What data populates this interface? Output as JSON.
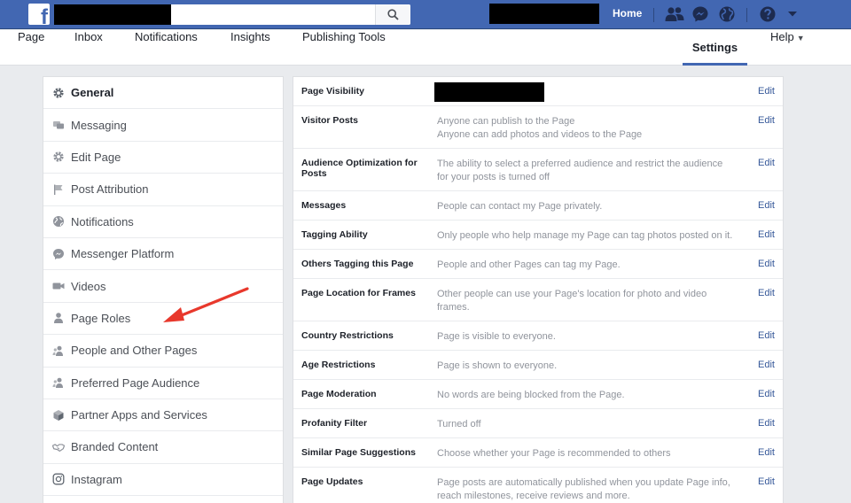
{
  "topbar": {
    "logo_letter": "f",
    "search_placeholder": "",
    "home_label": "Home"
  },
  "nav": {
    "items": [
      "Page",
      "Inbox",
      "Notifications",
      "Insights",
      "Publishing Tools"
    ],
    "settings_label": "Settings",
    "help_label": "Help"
  },
  "sidebar": {
    "items": [
      {
        "label": "General",
        "icon": "gear-icon"
      },
      {
        "label": "Messaging",
        "icon": "messaging-icon"
      },
      {
        "label": "Edit Page",
        "icon": "gear-icon"
      },
      {
        "label": "Post Attribution",
        "icon": "flag-icon"
      },
      {
        "label": "Notifications",
        "icon": "globe-icon"
      },
      {
        "label": "Messenger Platform",
        "icon": "messenger-icon"
      },
      {
        "label": "Videos",
        "icon": "video-icon"
      },
      {
        "label": "Page Roles",
        "icon": "person-icon"
      },
      {
        "label": "People and Other Pages",
        "icon": "people-icon"
      },
      {
        "label": "Preferred Page Audience",
        "icon": "people-icon"
      },
      {
        "label": "Partner Apps and Services",
        "icon": "cube-icon"
      },
      {
        "label": "Branded Content",
        "icon": "handshake-icon"
      },
      {
        "label": "Instagram",
        "icon": "instagram-icon"
      }
    ]
  },
  "settings": {
    "edit_label": "Edit",
    "rows": [
      {
        "label": "Page Visibility",
        "line1": "",
        "line2": ""
      },
      {
        "label": "Visitor Posts",
        "line1": "Anyone can publish to the Page",
        "line2": "Anyone can add photos and videos to the Page"
      },
      {
        "label": "Audience Optimization for Posts",
        "line1": "The ability to select a preferred audience and restrict the audience",
        "line2": "for your posts is turned off"
      },
      {
        "label": "Messages",
        "line1": "People can contact my Page privately.",
        "line2": ""
      },
      {
        "label": "Tagging Ability",
        "line1": "Only people who help manage my Page can tag photos posted on it.",
        "line2": ""
      },
      {
        "label": "Others Tagging this Page",
        "line1": "People and other Pages can tag my Page.",
        "line2": ""
      },
      {
        "label": "Page Location for Frames",
        "line1": "Other people can use your Page's location for photo and video",
        "line2": "frames."
      },
      {
        "label": "Country Restrictions",
        "line1": "Page is visible to everyone.",
        "line2": ""
      },
      {
        "label": "Age Restrictions",
        "line1": "Page is shown to everyone.",
        "line2": ""
      },
      {
        "label": "Page Moderation",
        "line1": "No words are being blocked from the Page.",
        "line2": ""
      },
      {
        "label": "Profanity Filter",
        "line1": "Turned off",
        "line2": ""
      },
      {
        "label": "Similar Page Suggestions",
        "line1": "Choose whether your Page is recommended to others",
        "line2": ""
      },
      {
        "label": "Page Updates",
        "line1": "Page posts are automatically published when you update Page info,",
        "line2": "reach milestones, receive reviews and more."
      }
    ]
  },
  "colors": {
    "brand_blue": "#4267b2",
    "link_blue": "#365899",
    "arrow_red": "#e8382c"
  }
}
